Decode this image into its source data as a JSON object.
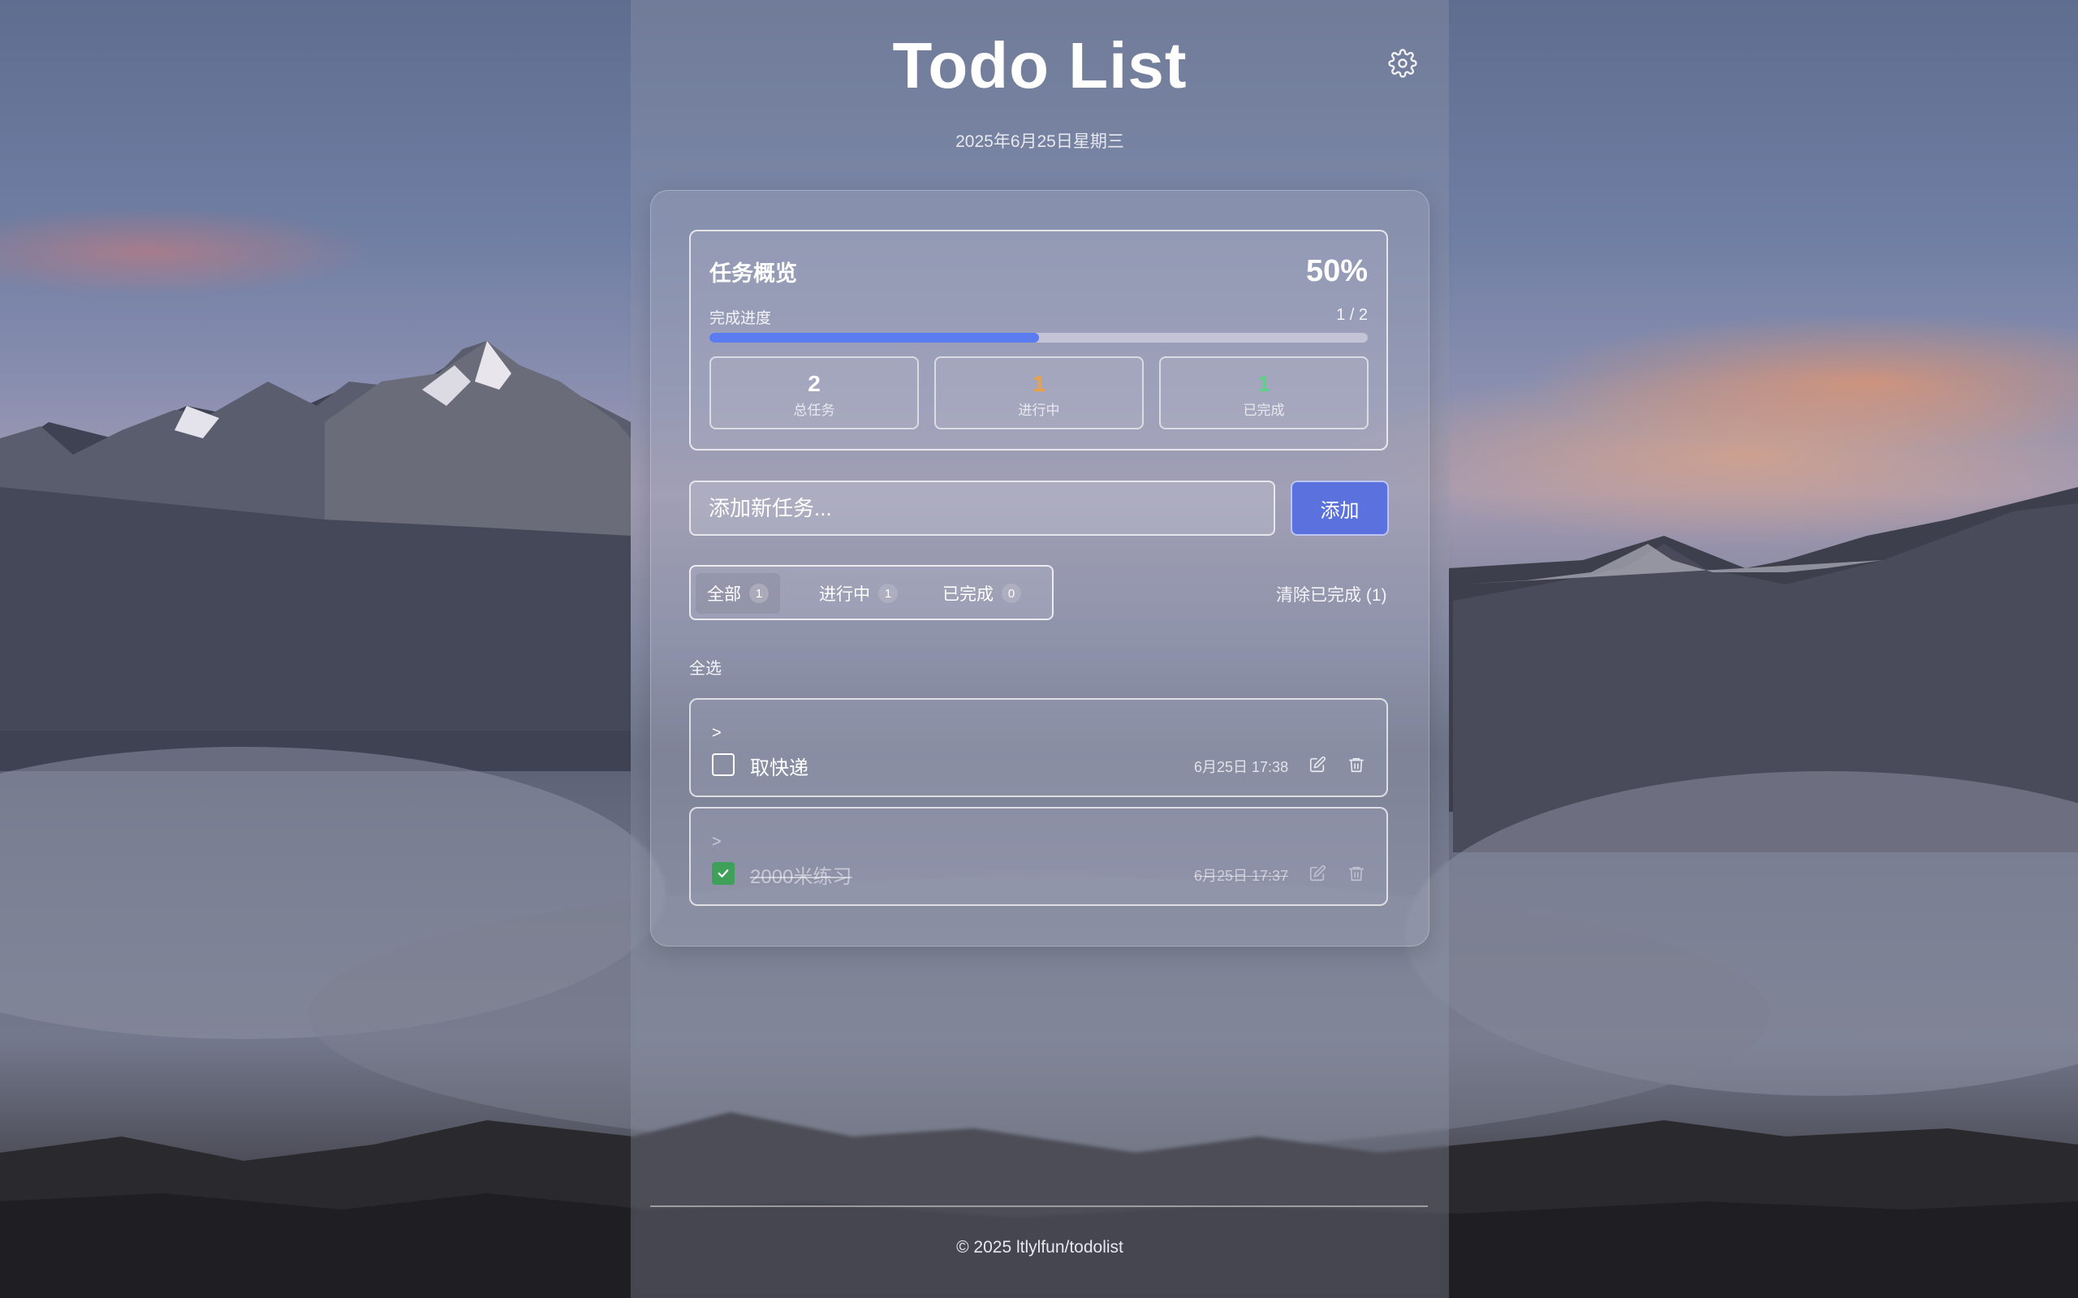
{
  "header": {
    "title": "Todo List",
    "date": "2025年6月25日星期三",
    "settings_icon": "gear-icon"
  },
  "overview": {
    "title": "任务概览",
    "percent": "50%",
    "progress_label": "完成进度",
    "progress_count": "1 / 2",
    "progress_fraction": 0.5,
    "progress_color": "#5b7cf0",
    "stats": [
      {
        "value": "2",
        "label": "总任务",
        "color": "#ffffff"
      },
      {
        "value": "1",
        "label": "进行中",
        "color": "#f0a040"
      },
      {
        "value": "1",
        "label": "已完成",
        "color": "#5fd08a"
      }
    ]
  },
  "input": {
    "placeholder": "添加新任务...",
    "add_label": "添加",
    "add_color": "#5b72de"
  },
  "filters": {
    "tabs": [
      {
        "label": "全部",
        "count": "1",
        "active": true
      },
      {
        "label": "进行中",
        "count": "1",
        "active": false
      },
      {
        "label": "已完成",
        "count": "0",
        "active": false
      }
    ],
    "clear_label": "清除已完成 (1)"
  },
  "select_all": "全选",
  "todos": [
    {
      "expand": ">",
      "text": "取快递",
      "time": "6月25日 17:38",
      "done": false
    },
    {
      "expand": ">",
      "text": "2000米练习",
      "time": "6月25日 17:37",
      "done": true
    }
  ],
  "footer": {
    "text": "© 2025 ltlylfun/todolist"
  }
}
